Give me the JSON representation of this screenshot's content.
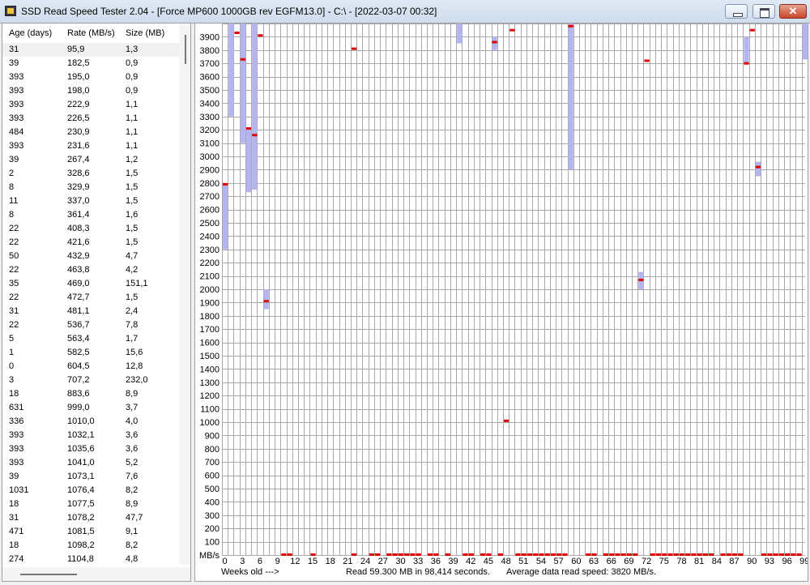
{
  "window": {
    "title": "SSD Read Speed Tester 2.04 - [Force MP600 1000GB rev EGFM13.0] - C:\\ - [2022-03-07 00:32]",
    "controls": {
      "minimize": "minimize",
      "maximize": "maximize",
      "close": "✕"
    }
  },
  "list": {
    "headers": {
      "age": "Age (days)",
      "rate": "Rate (MB/s)",
      "size": "Size (MB)"
    },
    "rows": [
      {
        "age": "31",
        "rate": "95,9",
        "size": "1,3"
      },
      {
        "age": "39",
        "rate": "182,5",
        "size": "0,9"
      },
      {
        "age": "393",
        "rate": "195,0",
        "size": "0,9"
      },
      {
        "age": "393",
        "rate": "198,0",
        "size": "0,9"
      },
      {
        "age": "393",
        "rate": "222,9",
        "size": "1,1"
      },
      {
        "age": "393",
        "rate": "226,5",
        "size": "1,1"
      },
      {
        "age": "484",
        "rate": "230,9",
        "size": "1,1"
      },
      {
        "age": "393",
        "rate": "231,6",
        "size": "1,1"
      },
      {
        "age": "39",
        "rate": "267,4",
        "size": "1,2"
      },
      {
        "age": "2",
        "rate": "328,6",
        "size": "1,5"
      },
      {
        "age": "8",
        "rate": "329,9",
        "size": "1,5"
      },
      {
        "age": "11",
        "rate": "337,0",
        "size": "1,5"
      },
      {
        "age": "8",
        "rate": "361,4",
        "size": "1,6"
      },
      {
        "age": "22",
        "rate": "408,3",
        "size": "1,5"
      },
      {
        "age": "22",
        "rate": "421,6",
        "size": "1,5"
      },
      {
        "age": "50",
        "rate": "432,9",
        "size": "4,7"
      },
      {
        "age": "22",
        "rate": "463,8",
        "size": "4,2"
      },
      {
        "age": "35",
        "rate": "469,0",
        "size": "151,1"
      },
      {
        "age": "22",
        "rate": "472,7",
        "size": "1,5"
      },
      {
        "age": "31",
        "rate": "481,1",
        "size": "2,4"
      },
      {
        "age": "22",
        "rate": "536,7",
        "size": "7,8"
      },
      {
        "age": "5",
        "rate": "563,4",
        "size": "1,7"
      },
      {
        "age": "1",
        "rate": "582,5",
        "size": "15,6"
      },
      {
        "age": "0",
        "rate": "604,5",
        "size": "12,8"
      },
      {
        "age": "3",
        "rate": "707,2",
        "size": "232,0"
      },
      {
        "age": "18",
        "rate": "883,6",
        "size": "8,9"
      },
      {
        "age": "631",
        "rate": "999,0",
        "size": "3,7"
      },
      {
        "age": "336",
        "rate": "1010,0",
        "size": "4,0"
      },
      {
        "age": "393",
        "rate": "1032,1",
        "size": "3,6"
      },
      {
        "age": "393",
        "rate": "1035,6",
        "size": "3,6"
      },
      {
        "age": "393",
        "rate": "1041,0",
        "size": "5,2"
      },
      {
        "age": "39",
        "rate": "1073,1",
        "size": "7,6"
      },
      {
        "age": "1031",
        "rate": "1076,4",
        "size": "8,2"
      },
      {
        "age": "18",
        "rate": "1077,5",
        "size": "8,9"
      },
      {
        "age": "31",
        "rate": "1078,2",
        "size": "47,7"
      },
      {
        "age": "471",
        "rate": "1081,5",
        "size": "9,1"
      },
      {
        "age": "18",
        "rate": "1098,2",
        "size": "8,2"
      },
      {
        "age": "274",
        "rate": "1104,8",
        "size": "4,8"
      }
    ]
  },
  "status": {
    "weeks_label": "Weeks old --->",
    "read_summary": "Read 59.300 MB in 98,414 seconds.",
    "average": "Average data read speed: 3820 MB/s."
  },
  "colors": {
    "grid": "#a8a8a8",
    "range": "#b4b4f0",
    "marker": "#e00000",
    "background": "#ffffff"
  },
  "chart_data": {
    "type": "bar",
    "ylabel": "MB/s",
    "xlabel": "Weeks old --->",
    "ylim": [
      0,
      4000
    ],
    "ytick_step": 100,
    "yticks_labeled": [
      100,
      200,
      300,
      400,
      500,
      600,
      700,
      800,
      900,
      1000,
      1100,
      1200,
      1300,
      1400,
      1500,
      1600,
      1700,
      1800,
      1900,
      2000,
      2100,
      2200,
      2300,
      2400,
      2500,
      2600,
      2700,
      2800,
      2900,
      3000,
      3100,
      3200,
      3300,
      3400,
      3500,
      3600,
      3700,
      3800,
      3900
    ],
    "xlim": [
      0,
      100
    ],
    "xticks_labeled": [
      0,
      3,
      6,
      9,
      12,
      15,
      18,
      21,
      24,
      27,
      30,
      33,
      36,
      39,
      42,
      45,
      48,
      51,
      54,
      57,
      60,
      63,
      66,
      69,
      72,
      75,
      78,
      81,
      84,
      87,
      90,
      93,
      96,
      99
    ],
    "ranges": [
      {
        "week": 0,
        "min": 2300,
        "max": 2800
      },
      {
        "week": 1,
        "min": 3300,
        "max": 4000
      },
      {
        "week": 3,
        "min": 3100,
        "max": 4000
      },
      {
        "week": 4,
        "min": 2730,
        "max": 3220
      },
      {
        "week": 5,
        "min": 2750,
        "max": 4000
      },
      {
        "week": 7,
        "min": 1850,
        "max": 2000
      },
      {
        "week": 40,
        "min": 3850,
        "max": 4000
      },
      {
        "week": 46,
        "min": 3800,
        "max": 3900
      },
      {
        "week": 59,
        "min": 2900,
        "max": 4000
      },
      {
        "week": 71,
        "min": 2000,
        "max": 2130
      },
      {
        "week": 89,
        "min": 3700,
        "max": 3900
      },
      {
        "week": 91,
        "min": 2850,
        "max": 2960
      },
      {
        "week": 99,
        "min": 3730,
        "max": 4000
      }
    ],
    "averages": [
      {
        "week": 0,
        "value": 2790
      },
      {
        "week": 2,
        "value": 3930
      },
      {
        "week": 3,
        "value": 3730
      },
      {
        "week": 4,
        "value": 3210
      },
      {
        "week": 5,
        "value": 3160
      },
      {
        "week": 6,
        "value": 3910
      },
      {
        "week": 7,
        "value": 1910
      },
      {
        "week": 22,
        "value": 3810
      },
      {
        "week": 46,
        "value": 3860
      },
      {
        "week": 48,
        "value": 1010
      },
      {
        "week": 49,
        "value": 3950
      },
      {
        "week": 59,
        "value": 3980
      },
      {
        "week": 71,
        "value": 2070
      },
      {
        "week": 72,
        "value": 3720
      },
      {
        "week": 89,
        "value": 3700
      },
      {
        "week": 90,
        "value": 3950
      },
      {
        "week": 91,
        "value": 2920
      }
    ],
    "baseline_weeks": [
      10,
      11,
      15,
      22,
      25,
      26,
      28,
      29,
      30,
      31,
      32,
      33,
      35,
      36,
      38,
      41,
      42,
      44,
      45,
      47,
      50,
      51,
      52,
      53,
      54,
      55,
      56,
      57,
      58,
      62,
      63,
      65,
      66,
      67,
      68,
      69,
      70,
      73,
      74,
      75,
      76,
      77,
      78,
      79,
      80,
      81,
      82,
      83,
      85,
      86,
      87,
      88,
      92,
      93,
      94,
      95,
      96,
      97,
      98
    ]
  }
}
